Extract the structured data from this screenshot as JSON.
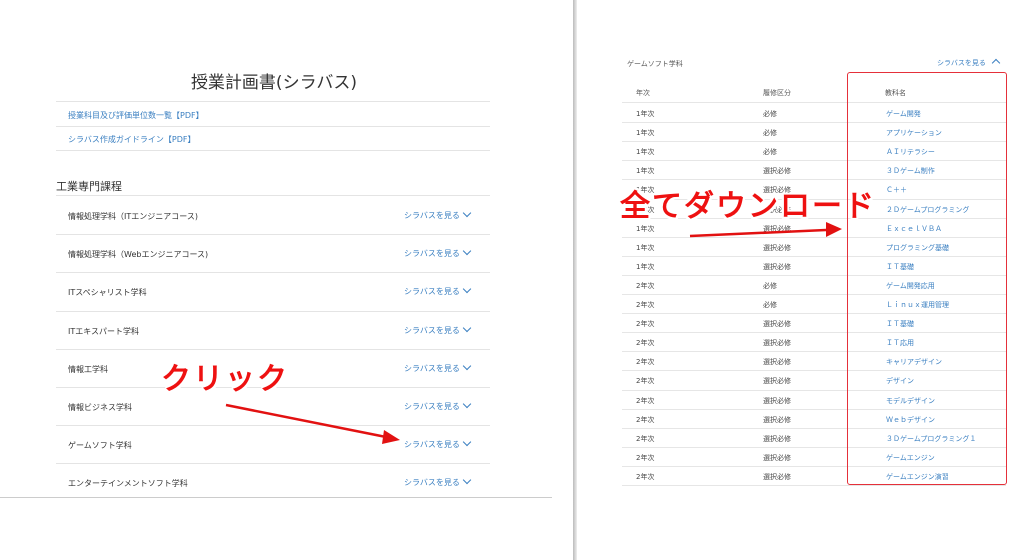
{
  "left": {
    "title": "授業計画書(シラバス)",
    "links": [
      "授業科目及び評価単位数一覧【PDF】",
      "シラバス作成ガイドライン【PDF】"
    ],
    "section_heading": "工業専門課程",
    "rows": [
      {
        "label": "情報処理学科（ITエンジニアコース)",
        "action": "シラバスを見る"
      },
      {
        "label": "情報処理学科（Webエンジニアコース)",
        "action": "シラバスを見る"
      },
      {
        "label": "ITスペシャリスト学科",
        "action": "シラバスを見る"
      },
      {
        "label": "ITエキスパート学科",
        "action": "シラバスを見る"
      },
      {
        "label": "情報工学科",
        "action": "シラバスを見る"
      },
      {
        "label": "情報ビジネス学科",
        "action": "シラバスを見る"
      },
      {
        "label": "ゲームソフト学科",
        "action": "シラバスを見る"
      },
      {
        "label": "エンターテインメントソフト学科",
        "action": "シラバスを見る"
      }
    ]
  },
  "right": {
    "dept": "ゲームソフト学科",
    "action": "シラバスを見る",
    "headers": {
      "year": "年次",
      "category": "履修区分",
      "subject": "教科名"
    },
    "rows": [
      {
        "year": "1年次",
        "category": "必修",
        "subject": "ゲーム開発"
      },
      {
        "year": "1年次",
        "category": "必修",
        "subject": "アプリケーション"
      },
      {
        "year": "1年次",
        "category": "必修",
        "subject": "ＡＩリテラシー"
      },
      {
        "year": "1年次",
        "category": "選択必修",
        "subject": "３Ｄゲーム制作"
      },
      {
        "year": "1年次",
        "category": "選択必修",
        "subject": "Ｃ＋＋"
      },
      {
        "year": "1年次",
        "category": "選択必修",
        "subject": "２Ｄゲームプログラミング"
      },
      {
        "year": "1年次",
        "category": "選択必修",
        "subject": "ＥｘｃｅｌＶＢＡ"
      },
      {
        "year": "1年次",
        "category": "選択必修",
        "subject": "プログラミング基礎"
      },
      {
        "year": "1年次",
        "category": "選択必修",
        "subject": "ＩＴ基礎"
      },
      {
        "year": "2年次",
        "category": "必修",
        "subject": "ゲーム開発応用"
      },
      {
        "year": "2年次",
        "category": "必修",
        "subject": "Ｌｉｎｕｘ運用管理"
      },
      {
        "year": "2年次",
        "category": "選択必修",
        "subject": "ＩＴ基礎"
      },
      {
        "year": "2年次",
        "category": "選択必修",
        "subject": "ＩＴ応用"
      },
      {
        "year": "2年次",
        "category": "選択必修",
        "subject": "キャリアデザイン"
      },
      {
        "year": "2年次",
        "category": "選択必修",
        "subject": "デザイン"
      },
      {
        "year": "2年次",
        "category": "選択必修",
        "subject": "モデルデザイン"
      },
      {
        "year": "2年次",
        "category": "選択必修",
        "subject": "Ｗｅｂデザイン"
      },
      {
        "year": "2年次",
        "category": "選択必修",
        "subject": "３Ｄゲームプログラミング１"
      },
      {
        "year": "2年次",
        "category": "選択必修",
        "subject": "ゲームエンジン"
      },
      {
        "year": "2年次",
        "category": "選択必修",
        "subject": "ゲームエンジン演習"
      }
    ]
  },
  "annotations": {
    "click": "クリック",
    "download_all": "全てダウンロード"
  },
  "colors": {
    "link": "#3a7fc1",
    "annotation": "#ee1111",
    "highlight_box": "#e5303a"
  }
}
